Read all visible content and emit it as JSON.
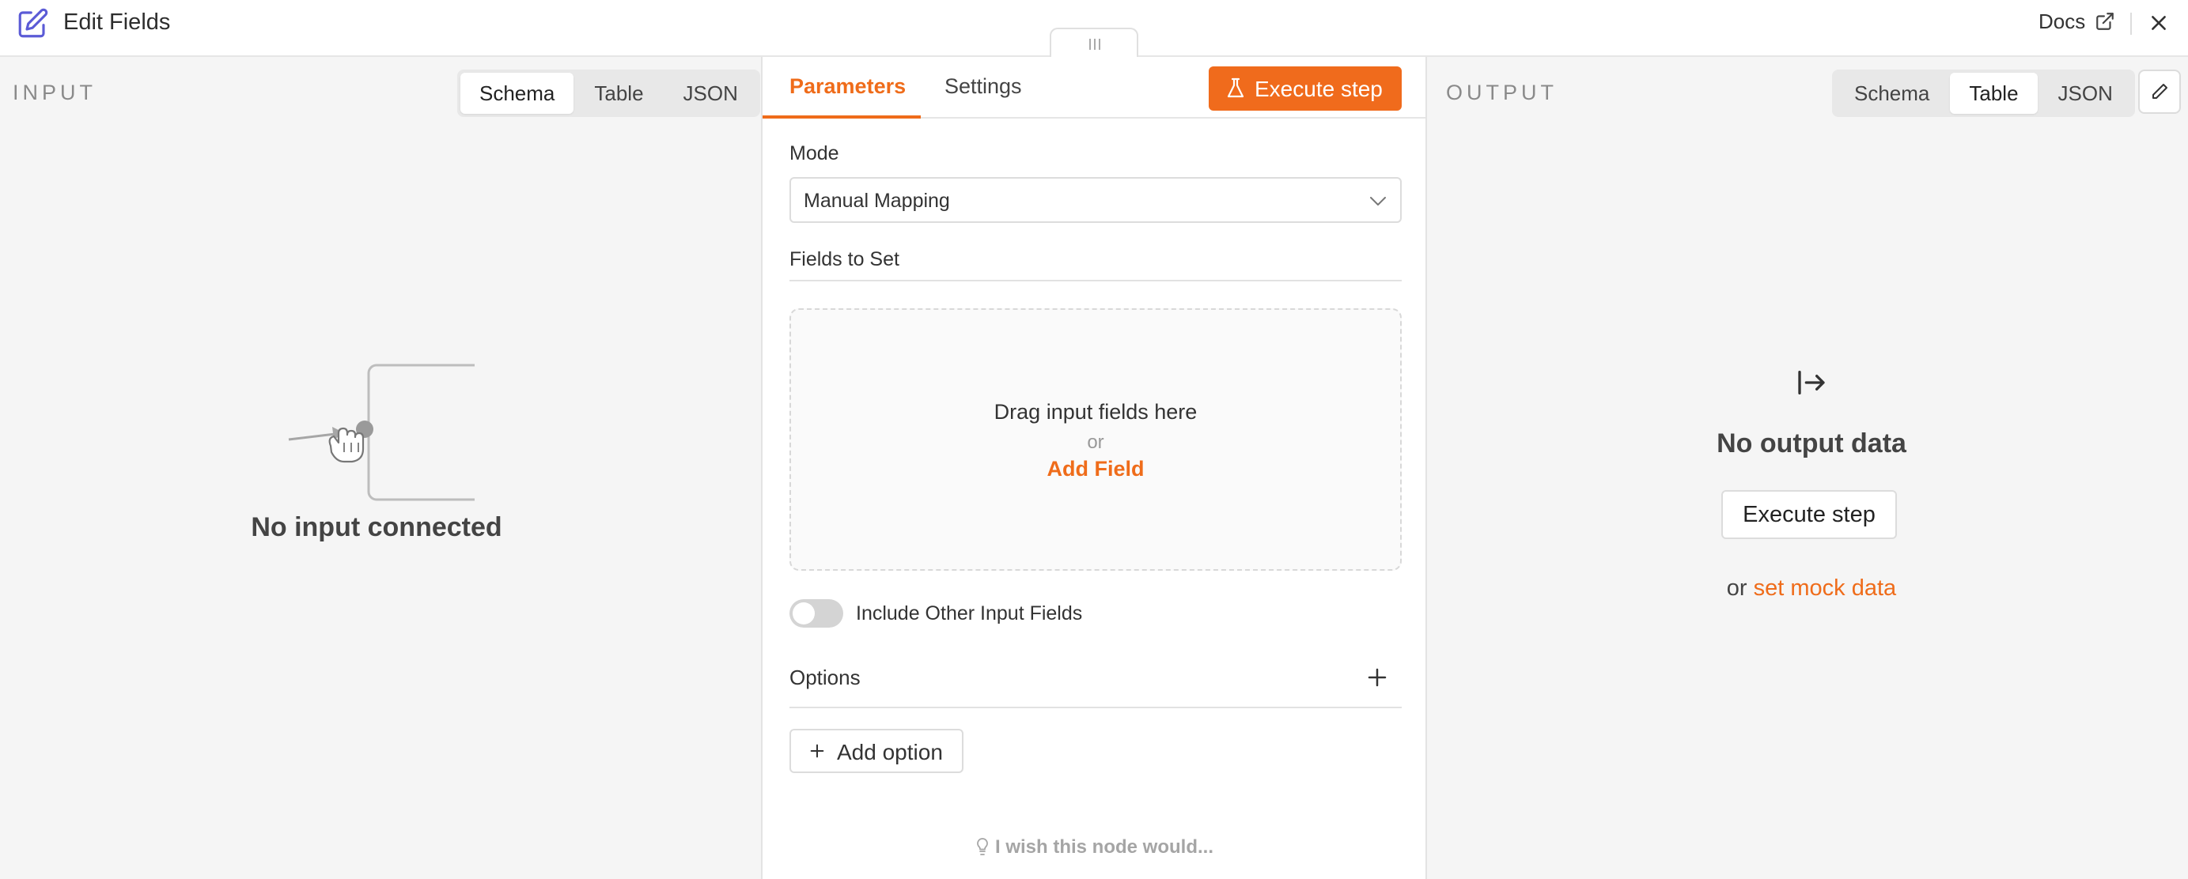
{
  "header": {
    "title": "Edit Fields",
    "docs_label": "Docs"
  },
  "input_panel": {
    "label": "INPUT",
    "tabs": [
      "Schema",
      "Table",
      "JSON"
    ],
    "active_tab": "Schema",
    "empty_text": "No input connected"
  },
  "center": {
    "tabs": [
      "Parameters",
      "Settings"
    ],
    "active_tab": "Parameters",
    "execute_label": "Execute step",
    "mode_label": "Mode",
    "mode_value": "Manual Mapping",
    "fields_label": "Fields to Set",
    "drop_main": "Drag input fields here",
    "drop_or": "or",
    "add_field": "Add Field",
    "include_label": "Include Other Input Fields",
    "include_enabled": false,
    "options_label": "Options",
    "add_option_label": "Add option",
    "feedback_text": "I wish this node would..."
  },
  "output_panel": {
    "label": "OUTPUT",
    "tabs": [
      "Schema",
      "Table",
      "JSON"
    ],
    "active_tab": "Table",
    "empty_title": "No output data",
    "execute_label": "Execute step",
    "or_text": "or",
    "mock_link": "set mock data"
  },
  "colors": {
    "accent": "#ef6c1a",
    "title_icon": "#5b5bd6"
  },
  "icons": [
    "edit-icon",
    "external-link-icon",
    "close-icon",
    "flask-icon",
    "chevron-down-icon",
    "plus-icon",
    "lightbulb-icon",
    "output-arrow-icon",
    "pencil-icon",
    "hand-cursor-icon"
  ]
}
